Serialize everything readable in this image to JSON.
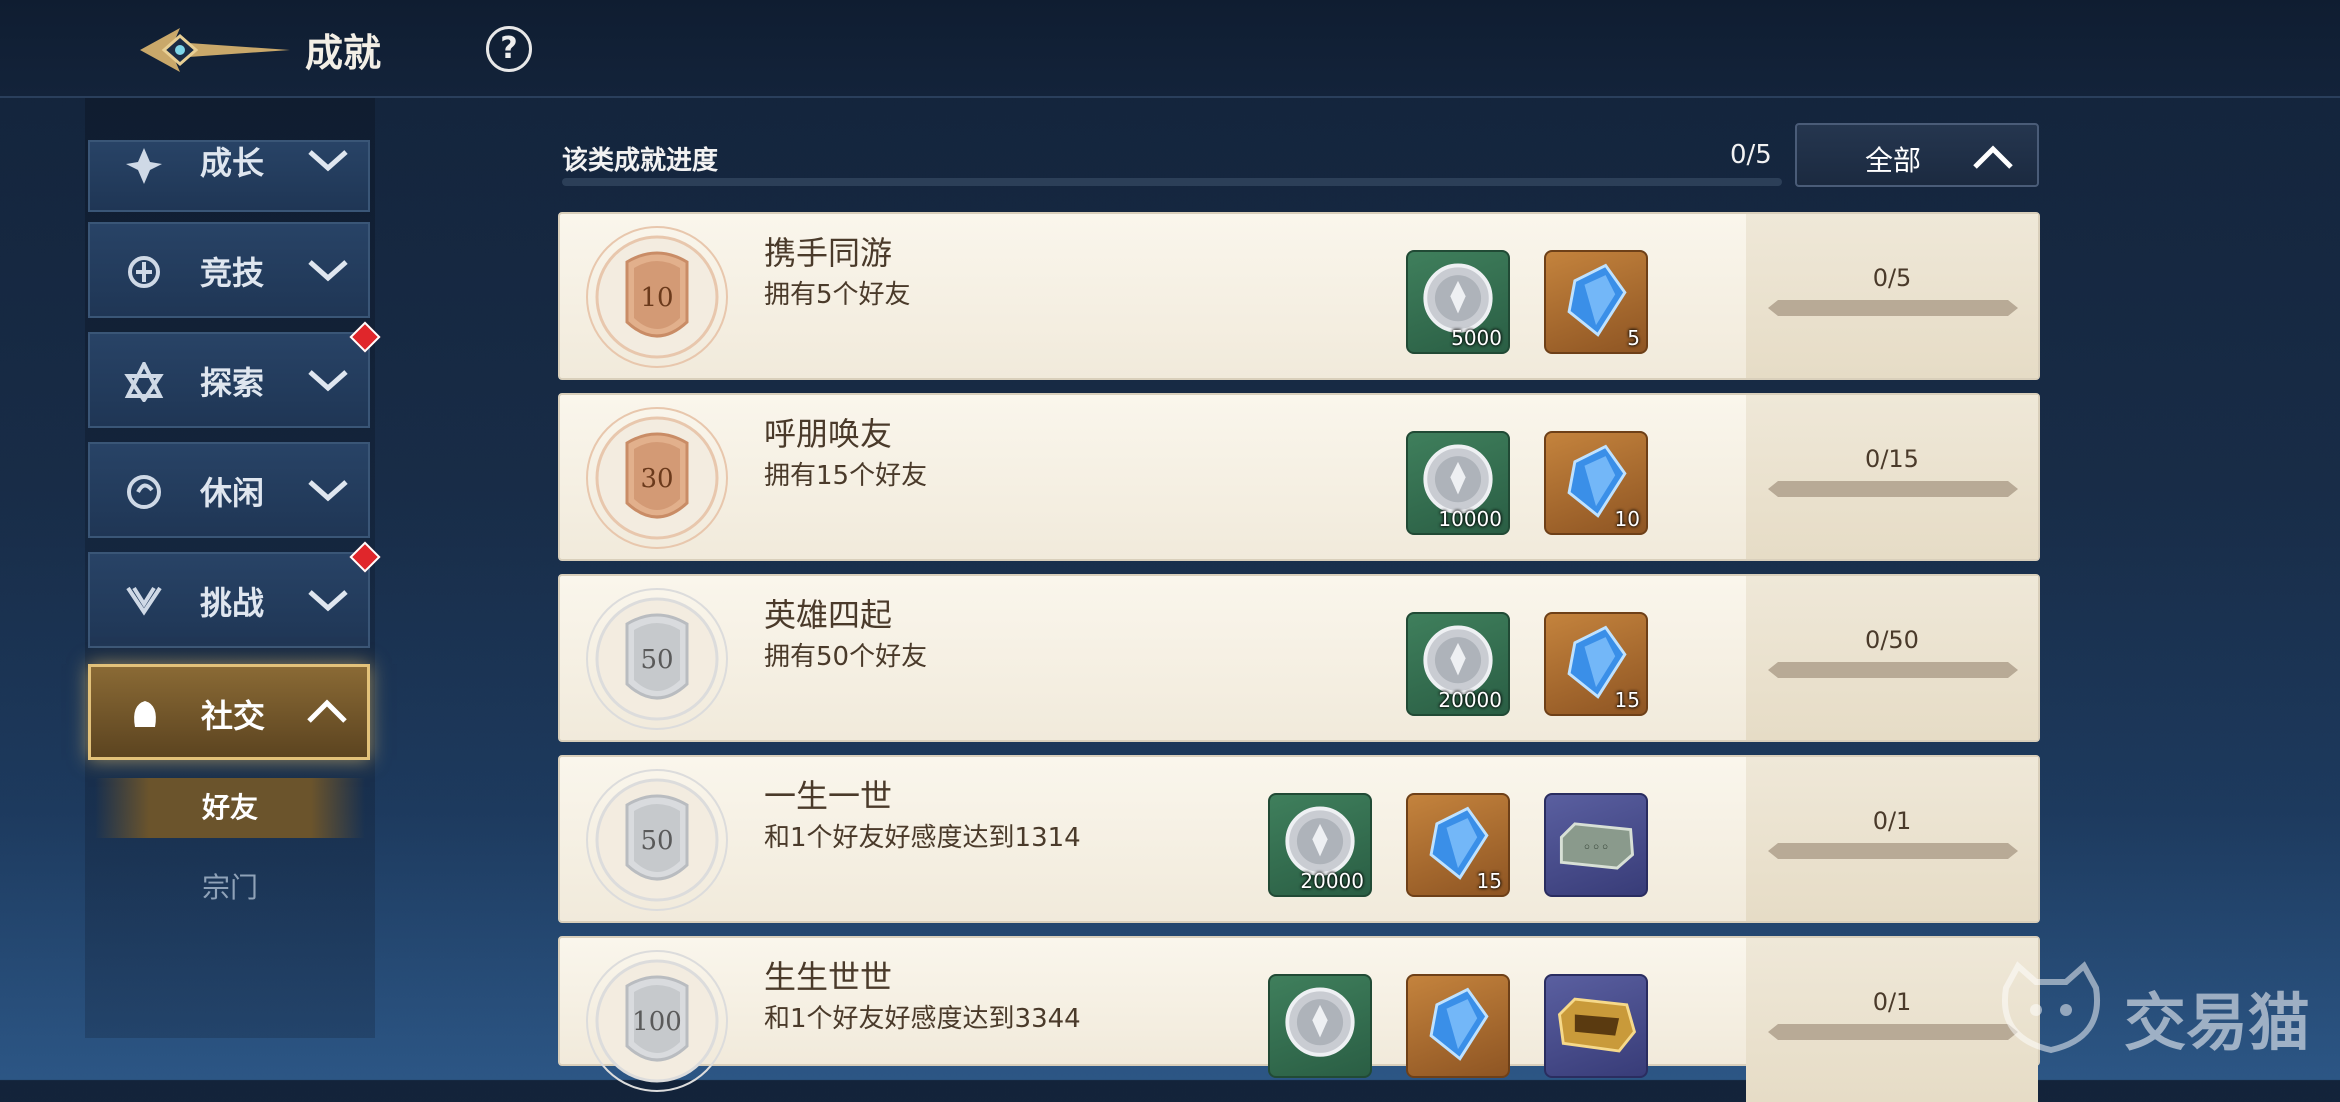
{
  "header": {
    "title": "成就",
    "help_icon": "question-icon",
    "back_icon": "back-arrow-icon"
  },
  "sidebar": {
    "categories": [
      {
        "label": "成长",
        "icon": "growth-icon",
        "has_alert": false,
        "expanded": false
      },
      {
        "label": "竞技",
        "icon": "arena-icon",
        "has_alert": false,
        "expanded": false
      },
      {
        "label": "探索",
        "icon": "explore-icon",
        "has_alert": true,
        "expanded": false
      },
      {
        "label": "休闲",
        "icon": "leisure-icon",
        "has_alert": false,
        "expanded": false
      },
      {
        "label": "挑战",
        "icon": "challenge-icon",
        "has_alert": true,
        "expanded": false
      },
      {
        "label": "社交",
        "icon": "social-icon",
        "has_alert": false,
        "expanded": true
      }
    ],
    "subitems": [
      {
        "label": "好友",
        "active": true
      },
      {
        "label": "宗门",
        "active": false
      }
    ]
  },
  "progress": {
    "label": "该类成就进度",
    "count": "0/5",
    "value": 0.0
  },
  "filter": {
    "label": "全部"
  },
  "achievements": [
    {
      "badge": "10",
      "badge_tier": "bronze",
      "name": "携手同游",
      "desc": "拥有5个好友",
      "progress": "0/5",
      "rewards": [
        {
          "type": "silver-coin",
          "qty": "5000"
        },
        {
          "type": "blue-crystal",
          "qty": "5"
        }
      ]
    },
    {
      "badge": "30",
      "badge_tier": "bronze",
      "name": "呼朋唤友",
      "desc": "拥有15个好友",
      "progress": "0/15",
      "rewards": [
        {
          "type": "silver-coin",
          "qty": "10000"
        },
        {
          "type": "blue-crystal",
          "qty": "10"
        }
      ]
    },
    {
      "badge": "50",
      "badge_tier": "silver",
      "name": "英雄四起",
      "desc": "拥有50个好友",
      "progress": "0/50",
      "rewards": [
        {
          "type": "silver-coin",
          "qty": "20000"
        },
        {
          "type": "blue-crystal",
          "qty": "15"
        }
      ]
    },
    {
      "badge": "50",
      "badge_tier": "silver",
      "name": "一生一世",
      "desc": "和1个好友好感度达到1314",
      "progress": "0/1",
      "rewards": [
        {
          "type": "silver-coin",
          "qty": "20000"
        },
        {
          "type": "blue-crystal",
          "qty": "15"
        },
        {
          "type": "title-plate",
          "qty": ""
        }
      ]
    },
    {
      "badge": "100",
      "badge_tier": "silver",
      "name": "生生世世",
      "desc": "和1个好友好感度达到3344",
      "progress": "0/1",
      "rewards": [
        {
          "type": "silver-coin",
          "qty": ""
        },
        {
          "type": "blue-crystal",
          "qty": ""
        },
        {
          "type": "gold-plate",
          "qty": ""
        }
      ]
    }
  ],
  "watermark": {
    "text": "交易猫"
  }
}
